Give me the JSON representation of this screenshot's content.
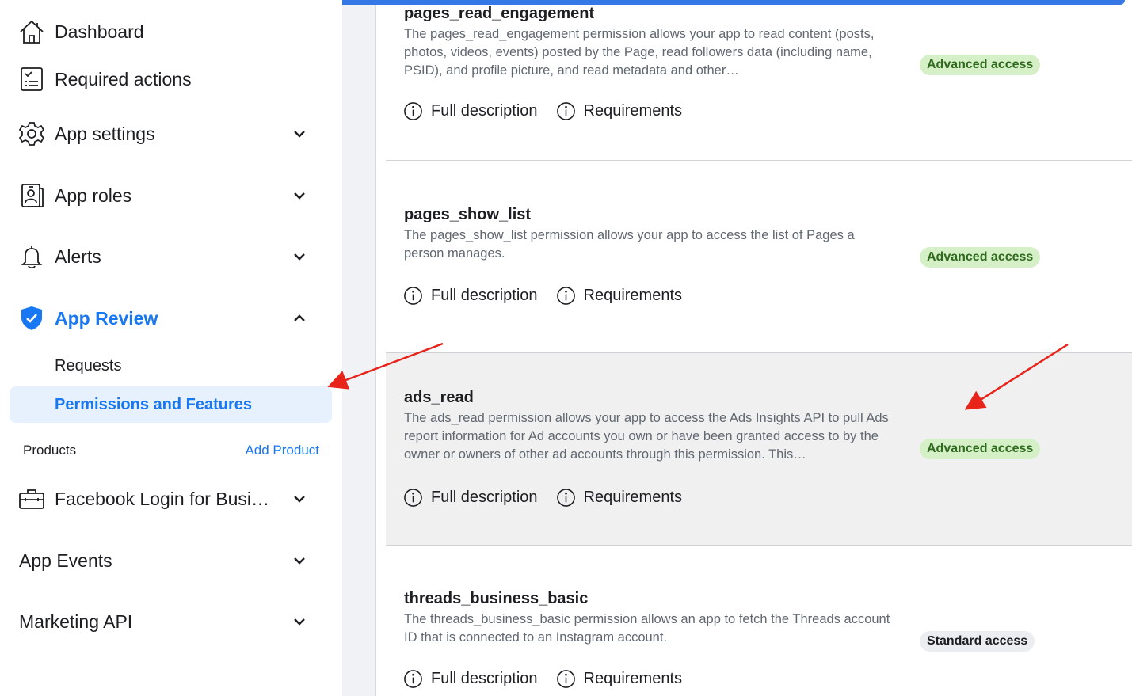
{
  "sidebar": {
    "items": [
      {
        "id": "dashboard",
        "label": "Dashboard",
        "icon": "home-icon",
        "has_chevron": false
      },
      {
        "id": "required-actions",
        "label": "Required actions",
        "icon": "checklist-icon",
        "has_chevron": false
      },
      {
        "id": "app-settings",
        "label": "App settings",
        "icon": "gear-icon",
        "has_chevron": true
      },
      {
        "id": "app-roles",
        "label": "App roles",
        "icon": "id-badge-icon",
        "has_chevron": true
      },
      {
        "id": "alerts",
        "label": "Alerts",
        "icon": "bell-icon",
        "has_chevron": true
      },
      {
        "id": "app-review",
        "label": "App Review",
        "icon": "shield-check-icon",
        "has_chevron": true,
        "expanded": true,
        "active": true
      }
    ],
    "app_review_sub": [
      {
        "label": "Requests",
        "selected": false
      },
      {
        "label": "Permissions and Features",
        "selected": true
      }
    ],
    "products": {
      "label": "Products",
      "add_label": "Add Product"
    },
    "product_items": [
      {
        "id": "facebook-login",
        "label": "Facebook Login for Busi…",
        "icon": "briefcase-icon",
        "has_chevron": true
      },
      {
        "id": "app-events",
        "label": "App Events",
        "has_chevron": true
      },
      {
        "id": "marketing-api",
        "label": "Marketing API",
        "has_chevron": true
      }
    ]
  },
  "permissions": [
    {
      "name": "pages_read_engagement",
      "description": "The pages_read_engagement permission allows your app to read content (posts, photos, videos, events) posted by the Page, read followers data (including name, PSID), and profile picture, and read metadata and other…",
      "full_description_label": "Full description",
      "requirements_label": "Requirements",
      "access": "Advanced access",
      "access_type": "advanced"
    },
    {
      "name": "pages_show_list",
      "description": "The pages_show_list permission allows your app to access the list of Pages a person manages.",
      "full_description_label": "Full description",
      "requirements_label": "Requirements",
      "access": "Advanced access",
      "access_type": "advanced"
    },
    {
      "name": "ads_read",
      "description": "The ads_read permission allows your app to access the Ads Insights API to pull Ads report information for Ad accounts you own or have been granted access to by the owner or owners of other ad accounts through this permission. This…",
      "full_description_label": "Full description",
      "requirements_label": "Requirements",
      "access": "Advanced access",
      "access_type": "advanced",
      "highlighted": true
    },
    {
      "name": "threads_business_basic",
      "description": "The threads_business_basic permission allows an app to fetch the Threads account ID that is connected to an Instagram account.",
      "full_description_label": "Full description",
      "requirements_label": "Requirements",
      "access": "Standard access",
      "access_type": "standard"
    }
  ],
  "colors": {
    "accent": "#1877f2",
    "advanced_bg": "#d5f0c7",
    "advanced_text": "#2f6a1e",
    "annotation_arrow": "#e8231a"
  }
}
